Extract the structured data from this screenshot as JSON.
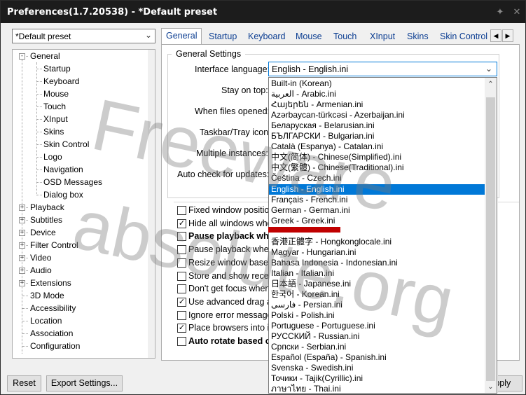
{
  "window": {
    "title": "Preferences(1.7.20538) - *Default preset",
    "pin_icon": "pin-icon",
    "close_icon": "close-icon"
  },
  "preset": {
    "value": "*Default preset"
  },
  "tree": {
    "items": [
      {
        "label": "General",
        "expander": "-"
      },
      {
        "label": "Startup"
      },
      {
        "label": "Keyboard"
      },
      {
        "label": "Mouse"
      },
      {
        "label": "Touch"
      },
      {
        "label": "XInput"
      },
      {
        "label": "Skins"
      },
      {
        "label": "Skin Control"
      },
      {
        "label": "Logo"
      },
      {
        "label": "Navigation"
      },
      {
        "label": "OSD Messages"
      },
      {
        "label": "Dialog box"
      },
      {
        "label": "Playback",
        "expander": "+"
      },
      {
        "label": "Subtitles",
        "expander": "+"
      },
      {
        "label": "Device",
        "expander": "+"
      },
      {
        "label": "Filter Control",
        "expander": "+"
      },
      {
        "label": "Video",
        "expander": "+"
      },
      {
        "label": "Audio",
        "expander": "+"
      },
      {
        "label": "Extensions",
        "expander": "+"
      },
      {
        "label": "3D Mode"
      },
      {
        "label": "Accessibility"
      },
      {
        "label": "Location"
      },
      {
        "label": "Association"
      },
      {
        "label": "Configuration"
      }
    ]
  },
  "tabs": [
    "General",
    "Startup",
    "Keyboard",
    "Mouse",
    "Touch",
    "XInput",
    "Skins",
    "Skin Control"
  ],
  "tab_scroll": {
    "left": "◀",
    "right": "▶"
  },
  "general": {
    "group_title": "General Settings",
    "interface_language_label": "Interface language:",
    "interface_language_value": "English - English.ini",
    "stay_on_top_label": "Stay on top:",
    "when_files_opened_label": "When files opened:",
    "taskbar_label": "Taskbar/Tray icon:",
    "multiple_instances_label": "Multiple instances:",
    "auto_check_label": "Auto check for updates:"
  },
  "checkboxes": [
    {
      "label": "Fixed window position",
      "checked": false,
      "bold": false
    },
    {
      "label": "Hide all windows whe",
      "checked": true,
      "bold": false
    },
    {
      "label": "Pause playback when",
      "checked": false,
      "bold": true
    },
    {
      "label": "Pause playback when",
      "checked": false,
      "bold": false
    },
    {
      "label": "Resize window based",
      "checked": false,
      "bold": false
    },
    {
      "label": "Store and show recen",
      "checked": false,
      "bold": false
    },
    {
      "label": "Don't get focus when",
      "checked": false,
      "bold": false
    },
    {
      "label": "Use advanced drag an",
      "checked": true,
      "bold": false
    },
    {
      "label": "Ignore error messages",
      "checked": false,
      "bold": false
    },
    {
      "label": "Place browsers into in",
      "checked": true,
      "bold": false
    },
    {
      "label": "Auto rotate based on",
      "checked": false,
      "bold": true
    }
  ],
  "languages": {
    "selected_index": 10,
    "items": [
      "Built-in (Korean)",
      "العربية - Arabic.ini",
      "Հայերեն - Armenian.ini",
      "Azərbaycan-türkcəsi - Azerbaijan.ini",
      "Беларуская - Belarusian.ini",
      "БЪЛГАРСКИ - Bulgarian.ini",
      "Català (Espanya) - Catalan.ini",
      "中文(简体) - Chinese(Simplified).ini",
      "中文(繁體) - Chinese(Traditional).ini",
      "Čeština - Czech.ini",
      "English - English.ini",
      "Français - French.ini",
      "German - German.ini",
      "Greek - Greek.ini",
      "",
      "香港正體字 - Hongkonglocale.ini",
      "Magyar - Hungarian.ini",
      "Bahasa Indonesia - Indonesian.ini",
      "Italian - Italian.ini",
      "日本語 - Japanese.ini",
      "한국어 - Korean.ini",
      "فارسی - Persian.ini",
      "Polski - Polish.ini",
      "Portuguese - Portuguese.ini",
      "РУССКИЙ - Russian.ini",
      "Српски - Serbian.ini",
      "Español (España) - Spanish.ini",
      "Svenska - Swedish.ini",
      "Точики - Tajik(Cyrillic).ini",
      "ภาษาไทย - Thai.ini"
    ]
  },
  "buttons": {
    "reset": "Reset",
    "export": "Export Settings...",
    "apply": "Apply"
  },
  "watermark": {
    "line1": "Freeware",
    "line2": "absolute.org"
  },
  "colors": {
    "titlebar": "#1c1c1c",
    "selection": "#0078d7",
    "link_tab": "#0b3d91",
    "marker": "#c00000"
  }
}
